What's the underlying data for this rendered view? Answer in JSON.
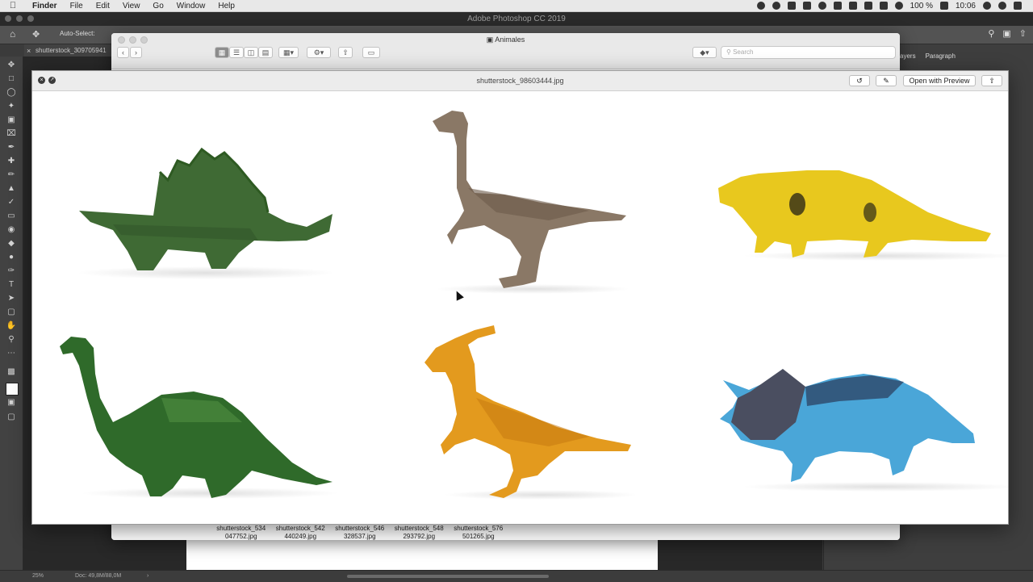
{
  "menubar": {
    "apple": "",
    "items": [
      "Finder",
      "File",
      "Edit",
      "View",
      "Go",
      "Window",
      "Help"
    ],
    "battery": "100 %",
    "time": "10:06"
  },
  "photoshop": {
    "window_title": "Adobe Photoshop CC 2019",
    "auto_select": "Auto-Select:",
    "doc_tab": "shutterstock_309705941",
    "panel_tabs": [
      "ayers",
      "Paragraph"
    ],
    "zoom": "25%",
    "doc_size": "Doc: 49,8M/88,0M"
  },
  "finder": {
    "title": "Animales",
    "search_placeholder": "Search",
    "files": [
      {
        "line1": "shutterstock_534",
        "line2": "047752.jpg"
      },
      {
        "line1": "shutterstock_542",
        "line2": "440249.jpg"
      },
      {
        "line1": "shutterstock_546",
        "line2": "328537.jpg"
      },
      {
        "line1": "shutterstock_548",
        "line2": "293792.jpg"
      },
      {
        "line1": "shutterstock_576",
        "line2": "501265.jpg"
      }
    ]
  },
  "quicklook": {
    "title": "shutterstock_98603444.jpg",
    "open_with": "Open with Preview"
  },
  "image": {
    "description_items": [
      "stegosaurus-toy",
      "raptor-toy",
      "ankylosaur-toy",
      "brachiosaurus-toy",
      "parasaurolophus-toy",
      "triceratops-toy"
    ],
    "colors": {
      "green": "#3f6a34",
      "brown": "#8a7866",
      "yellow": "#e8c81e",
      "dark_green": "#2f6a2a",
      "orange": "#e39a1e",
      "blue": "#4aa6d8"
    }
  }
}
